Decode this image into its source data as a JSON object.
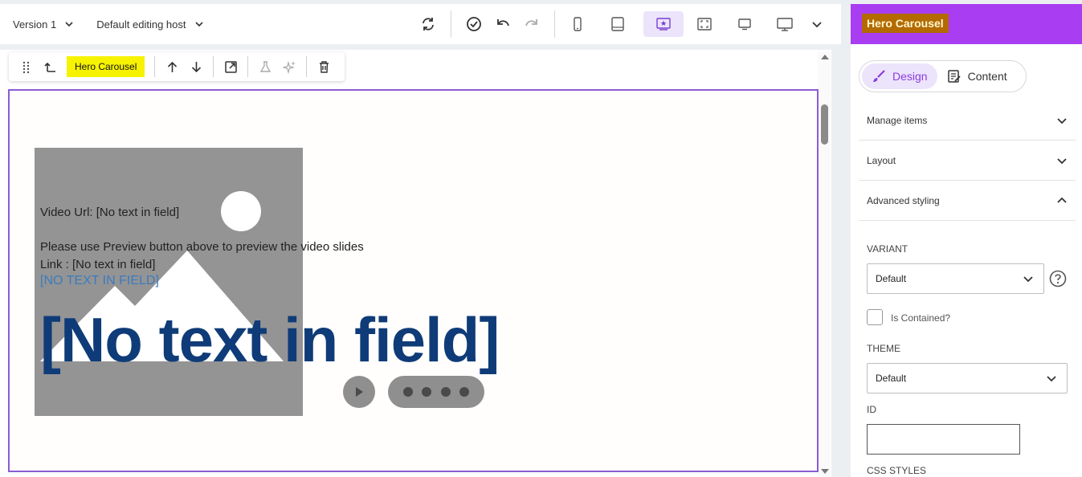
{
  "topbar": {
    "version_label": "Version 1",
    "host_label": "Default editing host"
  },
  "component_toolbar": {
    "component_name": "Hero Carousel"
  },
  "hero": {
    "video_url_text": "Video Url: [No text in field]",
    "preview_hint": "Please use Preview button above to preview the video slides",
    "link_text": "Link : [No text in field]",
    "link_value": "[NO TEXT IN FIELD]",
    "title": "[No text in field]"
  },
  "panel": {
    "title": "Hero Carousel",
    "tabs": [
      {
        "label": "Design",
        "active": true
      },
      {
        "label": "Content",
        "active": false
      }
    ],
    "sections": [
      {
        "label": "Manage items",
        "expanded": false
      },
      {
        "label": "Layout",
        "expanded": false
      },
      {
        "label": "Advanced styling",
        "expanded": true
      }
    ],
    "variant": {
      "label": "VARIANT",
      "value": "Default"
    },
    "contained": {
      "label": "Is Contained?",
      "checked": false
    },
    "theme": {
      "label": "THEME",
      "value": "Default"
    },
    "id_field": {
      "label": "ID",
      "value": ""
    },
    "css_styles_label": "CSS STYLES"
  },
  "colors": {
    "accent": "#a93df2",
    "selection_border": "#8a5cd6",
    "title_blue": "#0f3c78",
    "highlight_yellow": "#f7f200",
    "panel_title_bg": "#b36a00"
  }
}
